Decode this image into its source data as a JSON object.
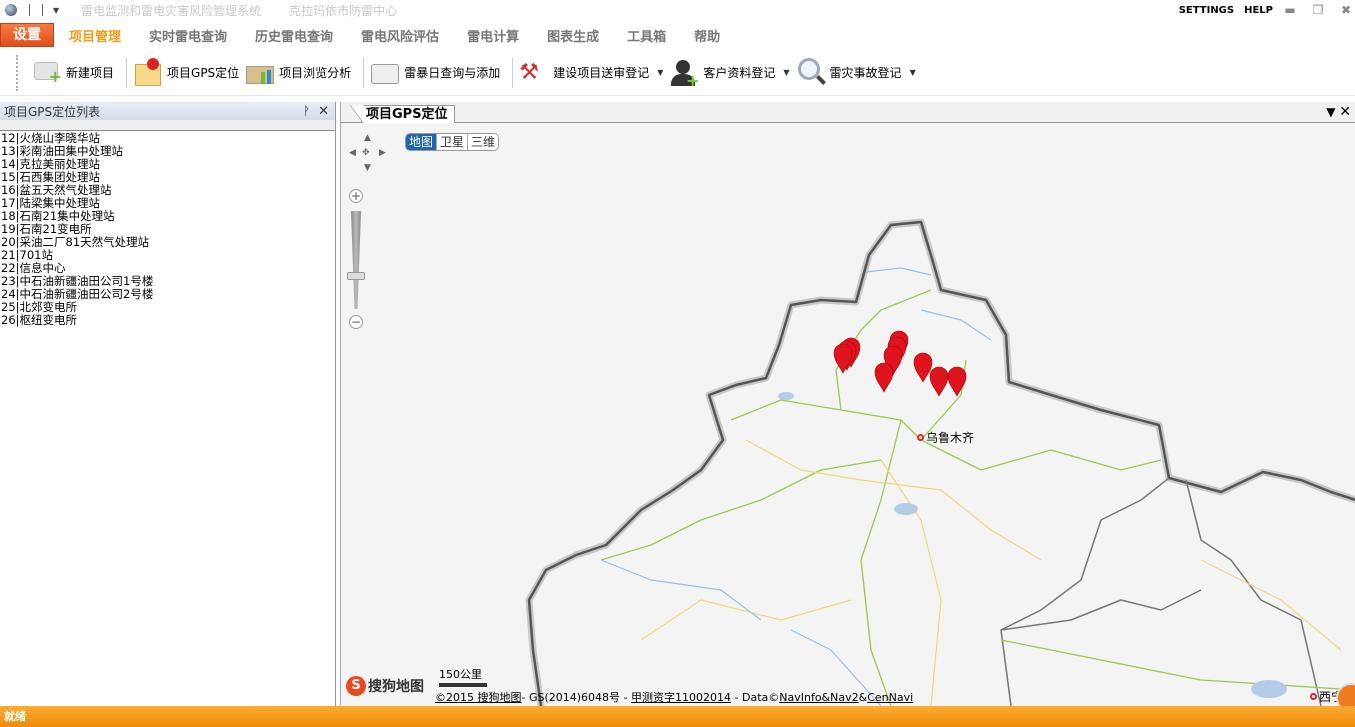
{
  "titlebar": {
    "title": "雷电监测和雷电灾害风险管理系统",
    "org": "克拉玛依市防雷中心",
    "settings": "SETTINGS",
    "help": "HELP"
  },
  "menu": {
    "settings_button": "设置",
    "items": [
      "项目管理",
      "实时雷电查询",
      "历史雷电查询",
      "雷电风险评估",
      "雷电计算",
      "图表生成",
      "工具箱",
      "帮助"
    ]
  },
  "toolbar": {
    "items": [
      "新建项目",
      "项目GPS定位",
      "项目浏览分析",
      "雷暴日查询与添加",
      "建设项目送审登记",
      "客户资料登记",
      "雷灾事故登记"
    ]
  },
  "left_panel": {
    "title": "项目GPS定位列表",
    "items": [
      "12|火烧山李晓华站",
      "13|彩南油田集中处理站",
      "14|克拉美丽处理站",
      "15|石西集团处理站",
      "16|盆五天然气处理站",
      "17|陆梁集中处理站",
      "18|石南21集中处理站",
      "19|石南21变电所",
      "20|采油二厂81天然气处理站",
      "21|701站",
      "22|信息中心",
      "23|中石油新疆油田公司1号楼",
      "24|中石油新疆油田公司2号楼",
      "25|北郊变电所",
      "26|枢纽变电所"
    ]
  },
  "map_panel": {
    "tab": "项目GPS定位",
    "map_types": [
      "地图",
      "卫星",
      "三维"
    ],
    "active_map_type": "地图",
    "cities": [
      "乌鲁木齐",
      "西宁"
    ],
    "scale": "150公里",
    "logo": "搜狗地图",
    "copyright": {
      "c1": "©2015 搜狗地图",
      "c2": "- GS(2014)6048号  - ",
      "c3": "甲测资字11002014",
      "c4": " - Data©",
      "c5": "NavInfo&Nav2",
      "c6": "&",
      "c7": "CenNavi"
    }
  },
  "status": "就绪",
  "colors": {
    "accent": "#f39a1b",
    "status_bar": "#f29416",
    "settings_button": "#e85a25",
    "marker": "#e0141e"
  }
}
